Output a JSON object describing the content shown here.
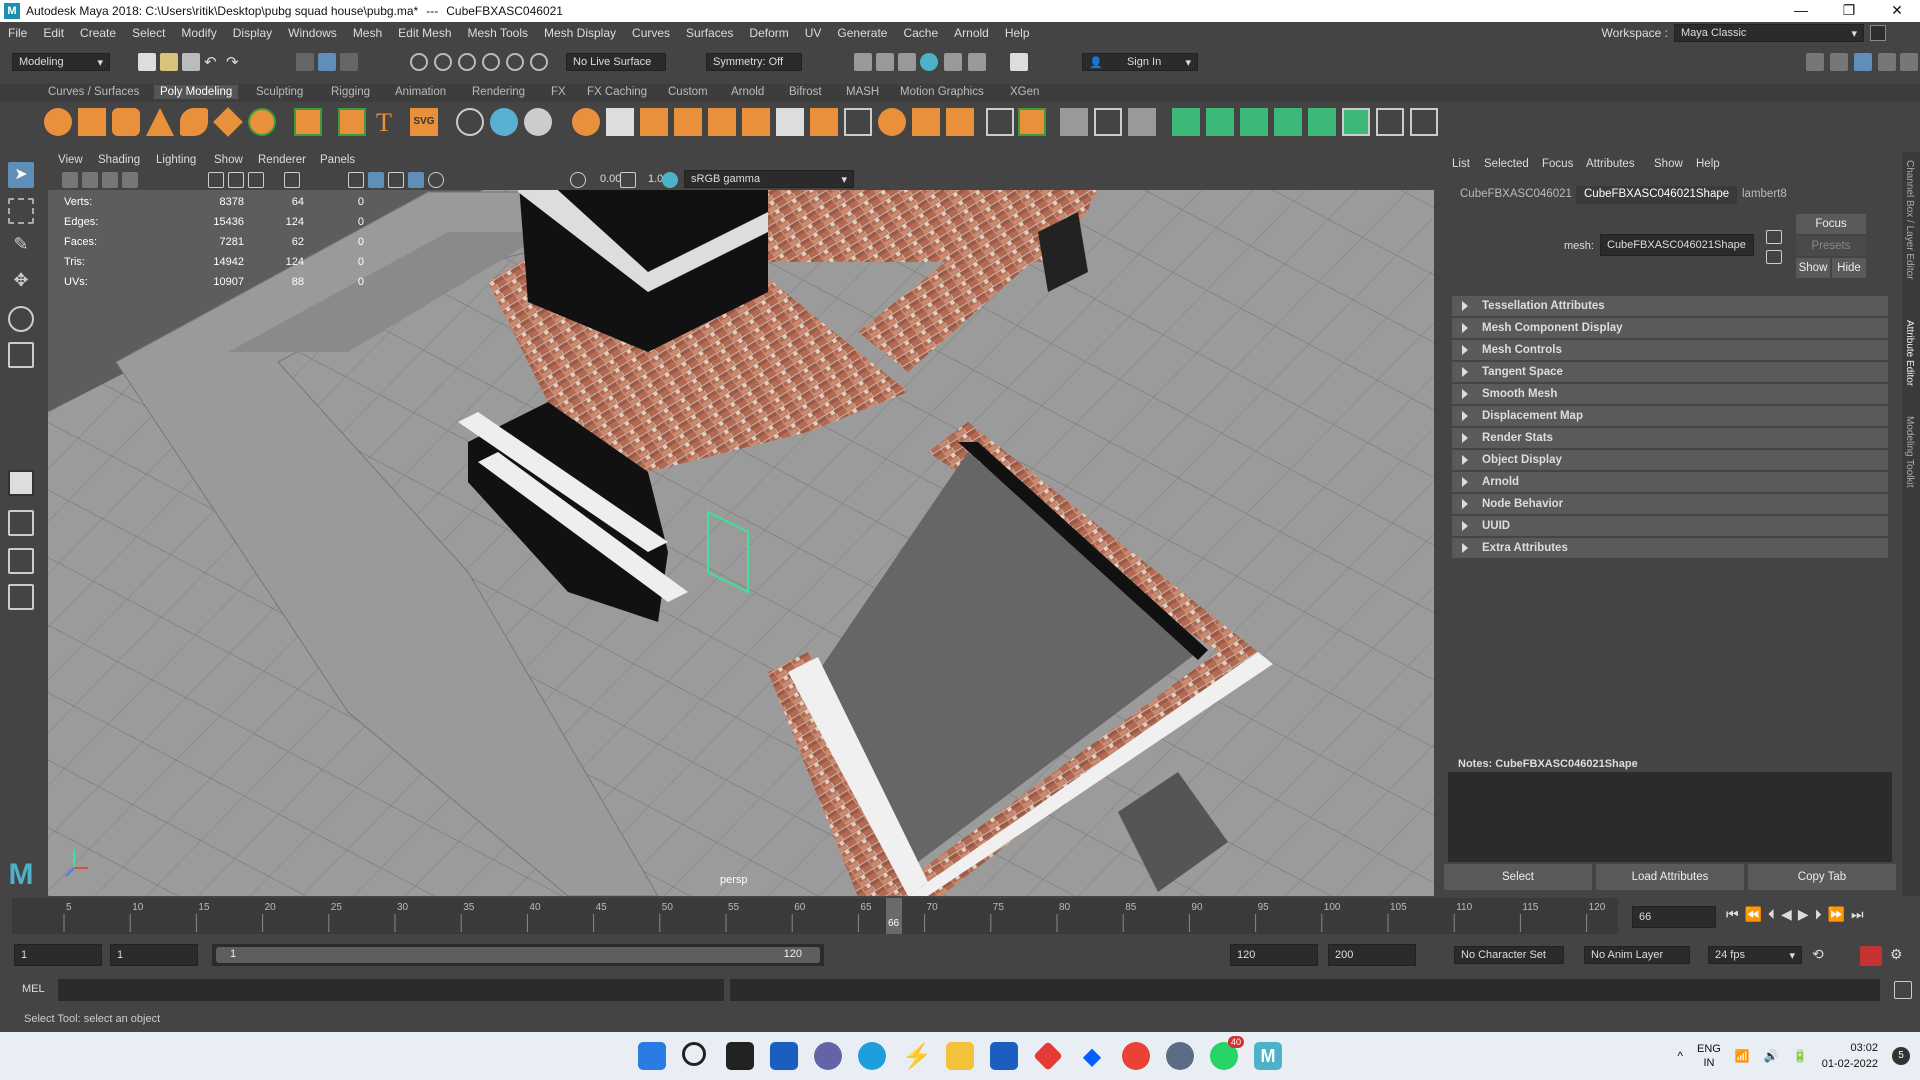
{
  "window": {
    "app_title": "Autodesk Maya 2018: C:\\Users\\ritik\\Desktop\\pubg squad house\\pubg.ma*",
    "separator": "---",
    "object": "CubeFBXASC046021",
    "minimize": "—",
    "maximize": "❐",
    "close": "✕"
  },
  "menubar": [
    "File",
    "Edit",
    "Create",
    "Select",
    "Modify",
    "Display",
    "Windows",
    "Mesh",
    "Edit Mesh",
    "Mesh Tools",
    "Mesh Display",
    "Curves",
    "Surfaces",
    "Deform",
    "UV",
    "Generate",
    "Cache",
    "Arnold",
    "Help"
  ],
  "workspace": {
    "label": "Workspace :",
    "value": "Maya Classic"
  },
  "statusline": {
    "mode": "Modeling",
    "live_surface": "No Live Surface",
    "symmetry": "Symmetry: Off",
    "sign_in": "Sign In"
  },
  "shelf_tabs": [
    "Curves / Surfaces",
    "Poly Modeling",
    "Sculpting",
    "Rigging",
    "Animation",
    "Rendering",
    "FX",
    "FX Caching",
    "Custom",
    "Arnold",
    "Bifrost",
    "MASH",
    "Motion Graphics",
    "XGen"
  ],
  "shelf_active": "Poly Modeling",
  "viewport": {
    "menu": [
      "View",
      "Shading",
      "Lighting",
      "Show",
      "Renderer",
      "Panels"
    ],
    "exposure": "0.00",
    "gamma": "1.00",
    "color_space": "sRGB gamma",
    "camera_label": "persp",
    "hud": [
      {
        "label": "Verts:",
        "v1": "8378",
        "v2": "64",
        "v3": "0"
      },
      {
        "label": "Edges:",
        "v1": "15436",
        "v2": "124",
        "v3": "0"
      },
      {
        "label": "Faces:",
        "v1": "7281",
        "v2": "62",
        "v3": "0"
      },
      {
        "label": "Tris:",
        "v1": "14942",
        "v2": "124",
        "v3": "0"
      },
      {
        "label": "UVs:",
        "v1": "10907",
        "v2": "88",
        "v3": "0"
      }
    ]
  },
  "attribute_editor": {
    "menu": [
      "List",
      "Selected",
      "Focus",
      "Attributes",
      "Show",
      "Help"
    ],
    "tabs": [
      "CubeFBXASC046021",
      "CubeFBXASC046021Shape",
      "lambert8"
    ],
    "active_tab": "CubeFBXASC046021Shape",
    "mesh_label": "mesh:",
    "mesh_value": "CubeFBXASC046021Shape",
    "focus": "Focus",
    "presets": "Presets",
    "show": "Show",
    "hide": "Hide",
    "sections": [
      "Tessellation Attributes",
      "Mesh Component Display",
      "Mesh Controls",
      "Tangent Space",
      "Smooth Mesh",
      "Displacement Map",
      "Render Stats",
      "Object Display",
      "Arnold",
      "Node Behavior",
      "UUID",
      "Extra Attributes"
    ],
    "notes_label": "Notes:  CubeFBXASC046021Shape",
    "buttons": [
      "Select",
      "Load Attributes",
      "Copy Tab"
    ]
  },
  "side_tabs": [
    "Channel Box / Layer Editor",
    "Attribute Editor",
    "Modeling Toolkit"
  ],
  "timeline": {
    "ticks": [
      "5",
      "10",
      "15",
      "20",
      "25",
      "30",
      "35",
      "40",
      "45",
      "50",
      "55",
      "60",
      "65",
      "70",
      "75",
      "80",
      "85",
      "90",
      "95",
      "100",
      "105",
      "110",
      "115",
      "120"
    ],
    "current_frame": "66",
    "current_field": "66"
  },
  "range": {
    "start": "1",
    "playback_start": "1",
    "slider_start": "1",
    "slider_end": "120",
    "playback_end": "120",
    "end": "200",
    "character_set": "No Character Set",
    "anim_layer": "No Anim Layer",
    "fps": "24 fps"
  },
  "cmdline": {
    "label": "MEL"
  },
  "help_line": "Select Tool: select an object",
  "tray": {
    "lang": "ENG",
    "region": "IN",
    "time": "03:02",
    "date": "01-02-2022",
    "notif": "5",
    "whatsapp_badge": "40"
  }
}
